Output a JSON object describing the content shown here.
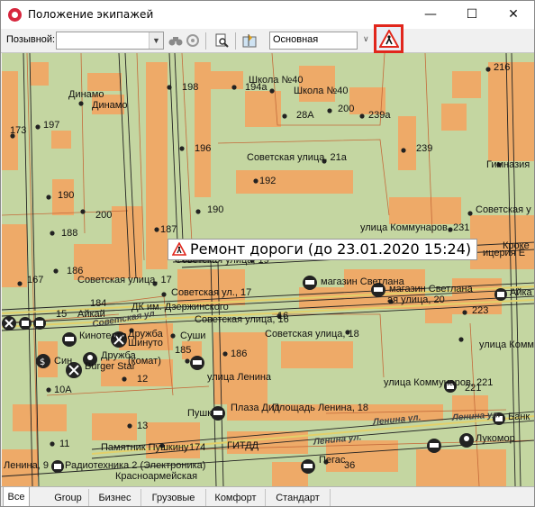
{
  "window": {
    "title": "Положение экипажей",
    "minimize": "—",
    "maximize": "☐",
    "close": "✕"
  },
  "toolbar": {
    "callsign_label": "Позывной:",
    "callsign_value": "",
    "layer_value": "Основная",
    "icons": [
      "search-binoculars-icon",
      "locate-icon",
      "document-search-icon",
      "map-pin-icon",
      "road-works-icon"
    ]
  },
  "map": {
    "popup_text": "Ремонт дороги (до 23.01.2020 15:24)",
    "labels": {
      "l198": "198",
      "l194a": "194а",
      "school940a": "Школа №40",
      "school940b": "Школа №40",
      "dinamo1": "Динамо",
      "dinamo2": "Динамо",
      "l197": "197",
      "l173": "173",
      "l216": "216",
      "l200a": "200",
      "l239a": "239а",
      "l28a": "28А",
      "l196": "196",
      "l239": "239",
      "sov21a": "Советская улица, 21а",
      "l192": "192",
      "gymn": "Гимназия",
      "l190a": "190",
      "l190b": "190",
      "l200b": "200",
      "l188": "188",
      "l187": "187",
      "komm231": "улица Коммунаров, 231",
      "sov_r": "Советская у",
      "kroke": "Кроке",
      "ptits": "ицерия Е",
      "sov19": "Советская улица, 19",
      "l186a": "186",
      "l167": "167",
      "sov17a": "Советская улица, 17",
      "sov17b": "Советская ул., 17",
      "mag1": "магазин Светлана",
      "mag2": "магазин Светлана",
      "sov20": "ая улица, 20",
      "aika_r": "Айка",
      "l184": "184",
      "aikai": "Айкай",
      "dk": "ДК им. Дзержинского",
      "sov16": "Советская улица, 16",
      "l223": "223",
      "l16": "16",
      "sov_ul": "Советская ул",
      "l15": "15",
      "l185a": "185",
      "kino": "Кинотеатр",
      "druzhba1": "Дружба",
      "shit": "Шинуто",
      "sushi": "Суши",
      "sov18": "Советская улица, 18",
      "komm_r": "улица Коммуна",
      "l185b": "185",
      "l186b": "186",
      "sin": "Син",
      "druzhba2": "Дружба",
      "burger": "Burger Star",
      "kom": "(комат)",
      "l12": "12",
      "l10a": "10А",
      "lenina": "улица Ленина",
      "komm221": "улица Коммунаров, 221",
      "pushk": "Пушк",
      "plaza": "Плаза Дид",
      "lenina18": "Площадь Ленина, 18",
      "l221": "221",
      "len_st1": "Ленина ул.",
      "len_st2": "Ленина ул.",
      "len_st3": "Ленина ул.",
      "l13": "13",
      "bank": "Банк",
      "lukom": "Лукомор",
      "l11": "11",
      "pamyat": "Памятник Пушкину",
      "l174": "174",
      "gitdd": "ГИТДД",
      "lenina9": "Ленина, 9",
      "radio": "Радиотехника 2 (Электроника)",
      "krasn": "Красноармейская",
      "l36": "36",
      "pegas": "Пегас"
    }
  },
  "tabs": [
    "Все",
    "Group",
    "Бизнес",
    "Грузовые",
    "Комфорт",
    "Стандарт"
  ],
  "colors": {
    "map_bg": "#c4d6a1",
    "building": "#eeaa68",
    "warning_border": "#e1261c"
  }
}
